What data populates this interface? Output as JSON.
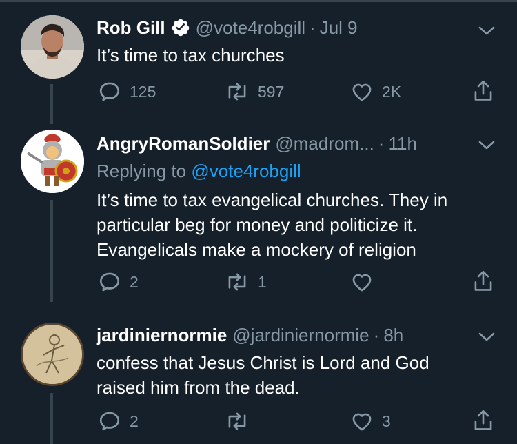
{
  "tweets": [
    {
      "name": "Rob Gill",
      "verified": true,
      "handle": "@vote4robgill",
      "time": "Jul 9",
      "text_lines": [
        "It’s time to tax churches"
      ],
      "replies": "125",
      "retweets": "597",
      "likes": "2K",
      "avatar_icon": "man-portrait-avatar"
    },
    {
      "name": "AngryRomanSoldier",
      "handle": "@madrom...",
      "time": "11h",
      "replying_prefix": "Replying to",
      "replying_to": "@vote4robgill",
      "text_lines": [
        "It’s time to tax evangelical churches. They in",
        "particular beg for money and politicize it.",
        "Evangelicals make a mockery of religion"
      ],
      "replies": "2",
      "retweets": "1",
      "likes": "",
      "avatar_icon": "roman-soldier-cartoon-avatar"
    },
    {
      "name": "jardiniernormie",
      "handle": "@jardiniernormie",
      "time": "8h",
      "text_lines": [
        "confess that Jesus Christ is Lord and God",
        "raised him from the dead."
      ],
      "replies": "2",
      "retweets": "",
      "likes": "3",
      "avatar_icon": "sketch-figure-avatar"
    }
  ],
  "separator": "·",
  "colors": {
    "background": "#15202b",
    "secondary_text": "#8899a6",
    "link": "#1da1f2",
    "thread_line": "#38444d"
  }
}
